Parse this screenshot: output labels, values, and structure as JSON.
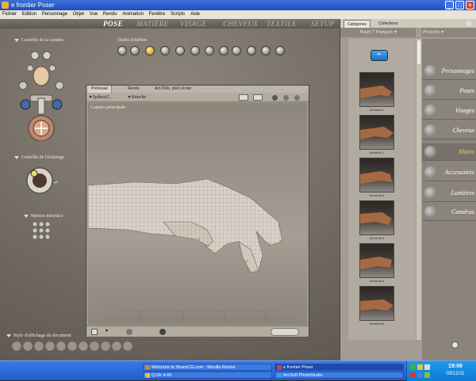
{
  "window": {
    "title": "e frontier Poser",
    "controls": {
      "minimize": "_",
      "maximize": "□",
      "close": "×"
    }
  },
  "menubar": [
    "Fichier",
    "Edition",
    "Personnage",
    "Objet",
    "Vue",
    "Rendu",
    "Animation",
    "Fenêtre",
    "Scripts",
    "Aide"
  ],
  "rooms": [
    "POSE",
    "MATIÈRE",
    "VISAGE",
    "CHEVEUX",
    "TEXTILE",
    "SETUP"
  ],
  "active_room": "POSE",
  "left_panel": {
    "camera_control_label": "Contrôle de la caméra",
    "lighting_control_label": "Contrôle de l'éclairage",
    "memos_label": "Mémos   interface",
    "display_style_label": "Style d'affichage du document"
  },
  "editing_tools_label": "Outils d'édition",
  "document": {
    "tabs": [
      "Prévisual",
      "Rendu",
      "Act./Dés. plein écran"
    ],
    "active_tab": "Prévisual",
    "figure_selector": "SydneyG...",
    "part_selector": "Hanche",
    "camera_label": "Caméra principale"
  },
  "library": {
    "tabs": [
      "Catégories",
      "Collections"
    ],
    "active_tab": "Catégories",
    "header": "Poser 7 Français",
    "up_button_icon": "folder-up-icon",
    "thumbnails": [
      "Arriverla 1",
      "Arriverla 2",
      "Arriverla 3",
      "Arriverla 4",
      "Arriverla 5",
      "Arriverla 6"
    ],
    "categories": [
      "Personnages",
      "Poses",
      "Visages",
      "Cheveux",
      "Mains",
      "Accessoires",
      "Lumières",
      "Caméras"
    ],
    "active_category": "Mains"
  },
  "taskbar": {
    "buttons": [
      "Welcome to ShareCG.com - Mozilla Firefox",
      "Q-Dir 4.65",
      "e frontier Poser",
      "ArcSoft PhotoStudio"
    ],
    "clock": {
      "time": "19:06",
      "date": "03/12/11"
    }
  },
  "colors": {
    "xp_titlebar": "#1f4fbf",
    "workspace": "#6e675f",
    "active_category": "#e8c070",
    "active_tool": "#d4a22c"
  }
}
